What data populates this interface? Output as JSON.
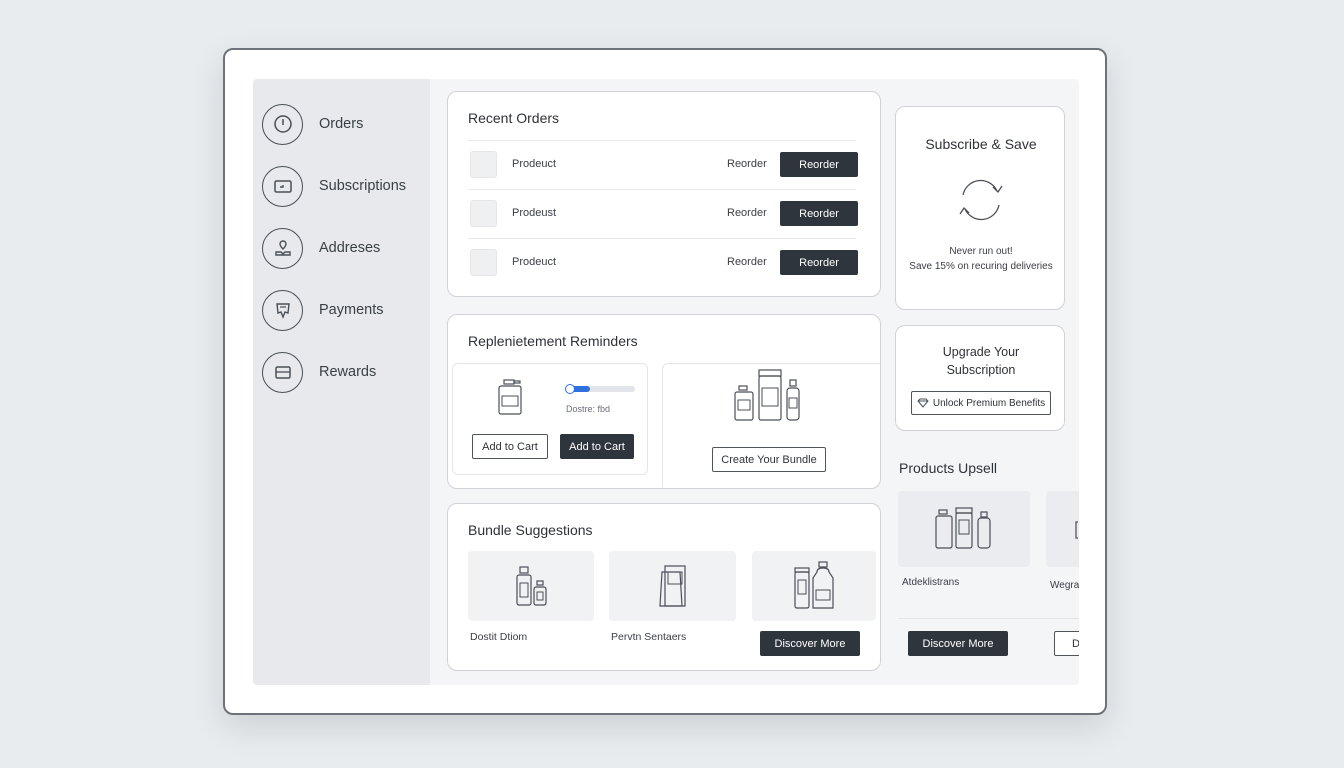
{
  "sidebar": {
    "items": [
      {
        "label": "Orders",
        "icon": "clock-icon"
      },
      {
        "label": "Subscriptions",
        "icon": "card-icon"
      },
      {
        "label": "Addreses",
        "icon": "location-icon"
      },
      {
        "label": "Payments",
        "icon": "receipt-icon"
      },
      {
        "label": "Rewards",
        "icon": "wallet-icon"
      }
    ]
  },
  "recent_orders": {
    "title": "Recent Orders",
    "rows": [
      {
        "name": "Prodeuct",
        "link": "Reorder",
        "button": "Reorder"
      },
      {
        "name": "Prodeust",
        "link": "Reorder",
        "button": "Reorder"
      },
      {
        "name": "Prodeuct",
        "link": "Reorder",
        "button": "Reorder"
      }
    ]
  },
  "replenishment": {
    "title": "Replenietement Reminders",
    "progress_label": "Dostre: fbd",
    "progress_value": 0.35,
    "add_to_cart_outline": "Add to Cart",
    "add_to_cart_filled": "Add to Cart",
    "bundle_button": "Create Your Bundle"
  },
  "bundle_suggestions": {
    "title": "Bundle Suggestions",
    "items": [
      {
        "label": "Dostit Dtiom"
      },
      {
        "label": "Pervtn Sentaers"
      }
    ],
    "discover_button": "Discover More"
  },
  "subscribe_save": {
    "title": "Subscribe & Save",
    "line1": "Never run out!",
    "line2": "Save 15% on recuring deliveries"
  },
  "upgrade": {
    "title_line1": "Upgrade Your",
    "title_line2": "Subscription",
    "button": "Unlock Premium Benefits"
  },
  "upsell": {
    "title": "Products Upsell",
    "items": [
      {
        "label": "Atdeklistrans",
        "button": "Discover More"
      },
      {
        "label": "Wegra",
        "button": "D"
      }
    ]
  },
  "colors": {
    "accent": "#2f6fe0",
    "dark_button": "#2f353d",
    "sidebar_bg": "#e7e9ec"
  }
}
